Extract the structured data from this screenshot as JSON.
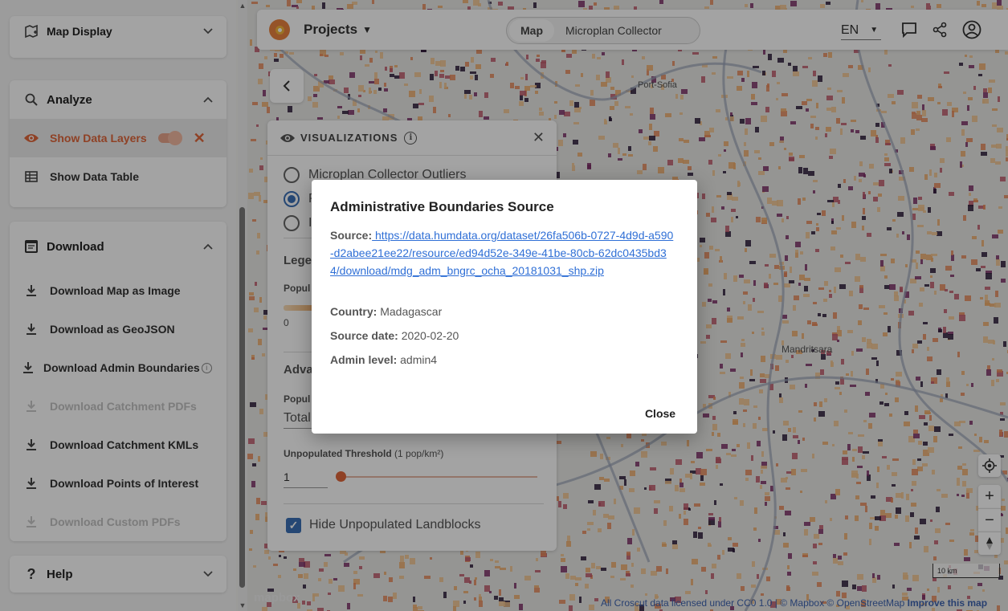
{
  "sidebar": {
    "map_display": {
      "label": "Map Display"
    },
    "analyze": {
      "label": "Analyze",
      "items": [
        {
          "label": "Show Data Layers",
          "active": true,
          "toggle_on": true
        },
        {
          "label": "Show Data Table"
        }
      ]
    },
    "download": {
      "label": "Download",
      "items": [
        {
          "label": "Download Map as Image",
          "disabled": false
        },
        {
          "label": "Download as GeoJSON",
          "disabled": false
        },
        {
          "label": "Download Admin Boundaries",
          "disabled": false,
          "has_info": true
        },
        {
          "label": "Download Catchment PDFs",
          "disabled": true
        },
        {
          "label": "Download Catchment KMLs",
          "disabled": false
        },
        {
          "label": "Download Points of Interest",
          "disabled": false
        },
        {
          "label": "Download Custom PDFs",
          "disabled": true
        }
      ]
    },
    "help": {
      "label": "Help"
    }
  },
  "topbar": {
    "projects_label": "Projects",
    "tabs": [
      {
        "label": "Map",
        "selected": true
      },
      {
        "label": "Microplan Collector",
        "selected": false
      }
    ],
    "language": "EN",
    "icons": [
      "chat-icon",
      "share-icon",
      "account-icon"
    ]
  },
  "map": {
    "places": [
      "Port-Sofia",
      "Mandritsara"
    ],
    "scale_label": "10 km",
    "mapbox_label": "mapbox",
    "attribution_text": "All Croscut data licensed under CC0 1.0 | © Mapbox © OpenStreetMap",
    "improve_link": "Improve this map"
  },
  "visualizations": {
    "title": "VISUALIZATIONS",
    "options": [
      {
        "label": "Microplan Collector Outliers",
        "checked": false
      },
      {
        "label": "P",
        "checked": true
      },
      {
        "label": "I",
        "checked": false
      }
    ],
    "legend_label": "Lege",
    "population_label": "Popul",
    "legend_min": "0",
    "advanced_label": "Adva",
    "population_select_label": "Popul",
    "population_select_value": "Total",
    "threshold_label": "Unpopulated Threshold",
    "threshold_unit": "(1 pop/km²)",
    "threshold_value": "1",
    "threshold_slider_fraction": 0.0,
    "hide_unpopulated_label": "Hide Unpopulated Landblocks",
    "hide_unpopulated_checked": true
  },
  "modal": {
    "title": "Administrative Boundaries Source",
    "source_label": "Source:",
    "source_url": " https://data.humdata.org/dataset/26fa506b-0727-4d9d-a590-d2abee21ee22/resource/ed94d52e-349e-41be-80cb-62dc0435bd34/download/mdg_adm_bngrc_ocha_20181031_shp.zip",
    "country_label": "Country:",
    "country_value": "Madagascar",
    "source_date_label": "Source date:",
    "source_date_value": "2020-02-20",
    "admin_level_label": "Admin level:",
    "admin_level_value": "admin4",
    "close_label": "Close"
  },
  "colors": {
    "accent": "#e0663a",
    "link": "#2f6fd6",
    "primary_blue": "#3b6fb6"
  }
}
